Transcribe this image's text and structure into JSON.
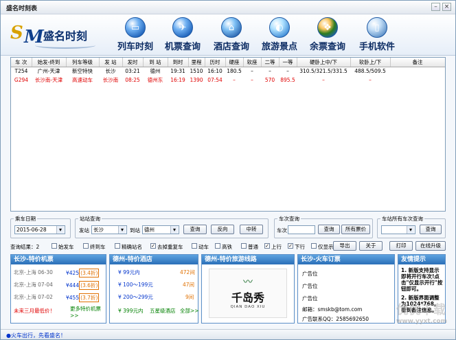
{
  "window": {
    "title": "盛名时刻表"
  },
  "logo": {
    "text": "盛名时刻"
  },
  "nav": [
    {
      "label": "列车时刻",
      "icon": "train-icon"
    },
    {
      "label": "机票查询",
      "icon": "plane-icon"
    },
    {
      "label": "酒店查询",
      "icon": "hotel-icon"
    },
    {
      "label": "旅游景点",
      "icon": "scenery-icon"
    },
    {
      "label": "余票查询",
      "icon": "ticket-icon"
    },
    {
      "label": "手机软件",
      "icon": "phone-icon"
    }
  ],
  "table": {
    "headers": [
      "车 次",
      "始发-终到",
      "列车等级",
      "发 站",
      "发时",
      "到 站",
      "到时",
      "里程",
      "历时",
      "硬座",
      "软座",
      "二等",
      "一等",
      "硬卧上中/下",
      "软卧上/下",
      "备注"
    ],
    "rows": [
      [
        "T254",
        "广州-天津",
        "新空特快",
        "长沙",
        "03:21",
        "德州",
        "19:31",
        "1510",
        "16:10",
        "180.5",
        "–",
        "–",
        "–",
        "310.5/321.5/331.5",
        "488.5/509.5",
        ""
      ],
      [
        "G294",
        "长沙南-天津",
        "高速动车",
        "长沙南",
        "08:25",
        "德州东",
        "16:19",
        "1390",
        "07:54",
        "–",
        "–",
        "570",
        "895.5",
        "–",
        "–",
        ""
      ]
    ]
  },
  "filters": {
    "date_group": "乘车日期",
    "date_value": "2015-06-28",
    "station_group": "站站查询",
    "from_label": "发站",
    "from_value": "长沙",
    "to_label": "到站",
    "to_value": "德州",
    "query_btn": "查询",
    "reverse_btn": "反向",
    "transfer_btn": "中转",
    "train_group": "车次查询",
    "train_label": "车次",
    "train_value": "",
    "train_query_btn": "查询",
    "all_fare_btn": "所有票价",
    "station_all_group": "车站所有车次查询",
    "station_all_value": "",
    "station_all_btn": "查询"
  },
  "result": {
    "label": "查询结果：2",
    "checks": [
      {
        "label": "始发车",
        "checked": false
      },
      {
        "label": "终到车",
        "checked": false
      },
      {
        "label": "精确站名",
        "checked": false
      },
      {
        "label": "去掉重复车",
        "checked": true
      },
      {
        "label": "动车",
        "checked": false
      },
      {
        "label": "高铁",
        "checked": false
      },
      {
        "label": "普通",
        "checked": false
      },
      {
        "label": "上行",
        "checked": true
      },
      {
        "label": "下行",
        "checked": true
      },
      {
        "label": "仅显示开行",
        "checked": false
      }
    ],
    "buttons": [
      "导出",
      "关于",
      "打印",
      "在线升级"
    ]
  },
  "panels": {
    "flights": {
      "title": "长沙-特价机票",
      "items": [
        {
          "route": "北京-上海 06-30",
          "price": "¥425",
          "discount": "(3.4折)"
        },
        {
          "route": "北京-上海 07-04",
          "price": "¥444",
          "discount": "(3.6折)"
        },
        {
          "route": "北京-上海 07-02",
          "price": "¥455",
          "discount": "(3.7折)"
        }
      ],
      "link1": "未来三月最低价！",
      "link2": "更多特价机票>>"
    },
    "hotels": {
      "title": "德州-特价酒店",
      "items": [
        {
          "range": "¥ 99元内",
          "count": "472间"
        },
        {
          "range": "¥ 100～199元",
          "count": "47间"
        },
        {
          "range": "¥ 200～299元",
          "count": "9间"
        }
      ],
      "link1": "¥ 399元内",
      "link2": "五星级酒店",
      "link3": "全部>>"
    },
    "tour": {
      "title": "德州-特价旅游线路",
      "ad_text": "千岛秀",
      "ad_sub": "QIAN DAO XIU"
    },
    "booking": {
      "title": "长沙-火车订票",
      "ads": [
        "广告位",
        "广告位",
        "广告位"
      ],
      "email": "邮箱：smskb@tom.com",
      "ad_contact": "广告联系QQ：2585692650"
    },
    "tips": {
      "title": "友情提示",
      "text1": "1. 新版支持显示即将开行车次!点击\"仅显示开行\"按钮即可。",
      "text2": "2. 新版界面调整为1024*768。看到备注信息。"
    }
  },
  "status": {
    "text": "●火车出行，先看盛名！"
  },
  "watermark": {
    "text": "优优下载",
    "url": "www.yyxt.com"
  }
}
